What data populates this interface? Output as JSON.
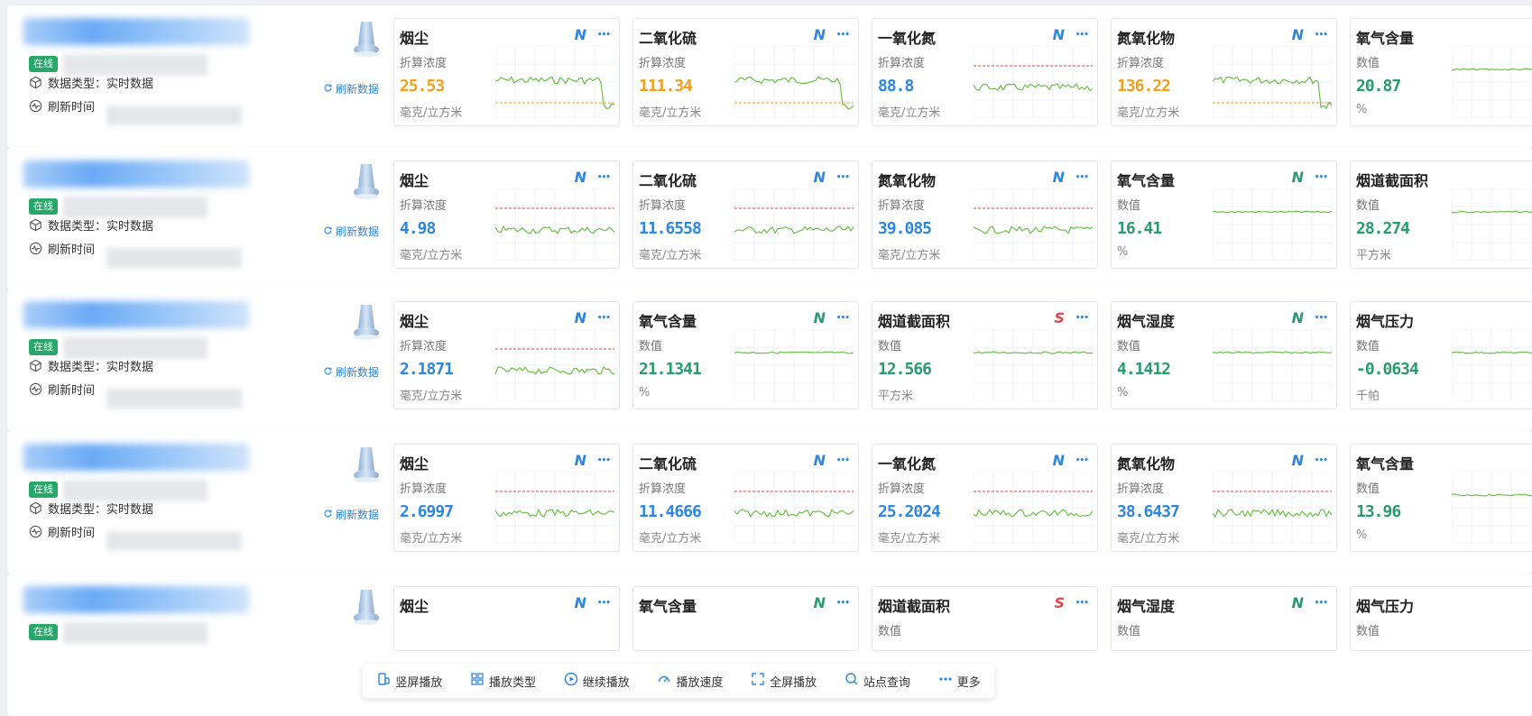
{
  "status_online": "在线",
  "data_type_label": "数据类型：",
  "data_type_value": "实时数据",
  "refresh_time_label": "刷新时间",
  "refresh_button": "刷新数据",
  "colors": {
    "blue": "#2f86e0",
    "green": "#2a9b6f",
    "orange": "#f0a01a",
    "red": "#e04848",
    "line": "#6cc04a"
  },
  "rows": [
    {
      "cards": [
        {
          "title": "烟尘",
          "flag": "N",
          "label": "折算浓度",
          "value": "25.53",
          "unit": "毫克/立方米",
          "value_color": "orange"
        },
        {
          "title": "二氧化硫",
          "flag": "N",
          "label": "折算浓度",
          "value": "111.34",
          "unit": "毫克/立方米",
          "value_color": "orange"
        },
        {
          "title": "一氧化氮",
          "flag": "N",
          "label": "折算浓度",
          "value": "88.8",
          "unit": "毫克/立方米",
          "value_color": "blue"
        },
        {
          "title": "氮氧化物",
          "flag": "N",
          "label": "折算浓度",
          "value": "136.22",
          "unit": "毫克/立方米",
          "value_color": "orange"
        },
        {
          "title": "氧气含量",
          "flag": "",
          "label": "数值",
          "value": "20.87",
          "unit": "%",
          "value_color": "green"
        }
      ]
    },
    {
      "cards": [
        {
          "title": "烟尘",
          "flag": "N",
          "label": "折算浓度",
          "value": "4.98",
          "unit": "毫克/立方米",
          "value_color": "blue"
        },
        {
          "title": "二氧化硫",
          "flag": "N",
          "label": "折算浓度",
          "value": "11.6558",
          "unit": "毫克/立方米",
          "value_color": "blue"
        },
        {
          "title": "氮氧化物",
          "flag": "N",
          "label": "折算浓度",
          "value": "39.085",
          "unit": "毫克/立方米",
          "value_color": "blue"
        },
        {
          "title": "氧气含量",
          "flag": "N",
          "label": "数值",
          "value": "16.41",
          "unit": "%",
          "value_color": "green"
        },
        {
          "title": "烟道截面积",
          "flag": "",
          "label": "数值",
          "value": "28.274",
          "unit": "平方米",
          "value_color": "green"
        }
      ]
    },
    {
      "cards": [
        {
          "title": "烟尘",
          "flag": "N",
          "label": "折算浓度",
          "value": "2.1871",
          "unit": "毫克/立方米",
          "value_color": "blue"
        },
        {
          "title": "氧气含量",
          "flag": "N",
          "label": "数值",
          "value": "21.1341",
          "unit": "%",
          "value_color": "green"
        },
        {
          "title": "烟道截面积",
          "flag": "S",
          "label": "数值",
          "value": "12.566",
          "unit": "平方米",
          "value_color": "green"
        },
        {
          "title": "烟气湿度",
          "flag": "N",
          "label": "数值",
          "value": "4.1412",
          "unit": "%",
          "value_color": "green"
        },
        {
          "title": "烟气压力",
          "flag": "",
          "label": "数值",
          "value": "-0.0634",
          "unit": "千帕",
          "value_color": "green"
        }
      ]
    },
    {
      "cards": [
        {
          "title": "烟尘",
          "flag": "N",
          "label": "折算浓度",
          "value": "2.6997",
          "unit": "毫克/立方米",
          "value_color": "blue"
        },
        {
          "title": "二氧化硫",
          "flag": "N",
          "label": "折算浓度",
          "value": "11.4666",
          "unit": "毫克/立方米",
          "value_color": "blue"
        },
        {
          "title": "一氧化氮",
          "flag": "N",
          "label": "折算浓度",
          "value": "25.2024",
          "unit": "毫克/立方米",
          "value_color": "blue"
        },
        {
          "title": "氮氧化物",
          "flag": "N",
          "label": "折算浓度",
          "value": "38.6437",
          "unit": "毫克/立方米",
          "value_color": "blue"
        },
        {
          "title": "氧气含量",
          "flag": "",
          "label": "数值",
          "value": "13.96",
          "unit": "%",
          "value_color": "green"
        }
      ]
    },
    {
      "cards": [
        {
          "title": "烟尘",
          "flag": "N",
          "label": "",
          "value": "",
          "unit": "",
          "value_color": "blue"
        },
        {
          "title": "氧气含量",
          "flag": "N",
          "label": "",
          "value": "",
          "unit": "",
          "value_color": "green"
        },
        {
          "title": "烟道截面积",
          "flag": "S",
          "label": "数值",
          "value": "",
          "unit": "",
          "value_color": "green"
        },
        {
          "title": "烟气湿度",
          "flag": "N",
          "label": "数值",
          "value": "",
          "unit": "",
          "value_color": "green"
        },
        {
          "title": "烟气压力",
          "flag": "",
          "label": "数值",
          "value": "",
          "unit": "",
          "value_color": "green"
        }
      ]
    }
  ],
  "toolbar": [
    {
      "label": "竖屏播放",
      "icon": "portrait-screen-icon"
    },
    {
      "label": "播放类型",
      "icon": "grid-icon"
    },
    {
      "label": "继续播放",
      "icon": "play-icon"
    },
    {
      "label": "播放速度",
      "icon": "speed-icon"
    },
    {
      "label": "全屏播放",
      "icon": "fullscreen-icon"
    },
    {
      "label": "站点查询",
      "icon": "search-icon"
    },
    {
      "label": "更多",
      "icon": "more-icon"
    }
  ]
}
